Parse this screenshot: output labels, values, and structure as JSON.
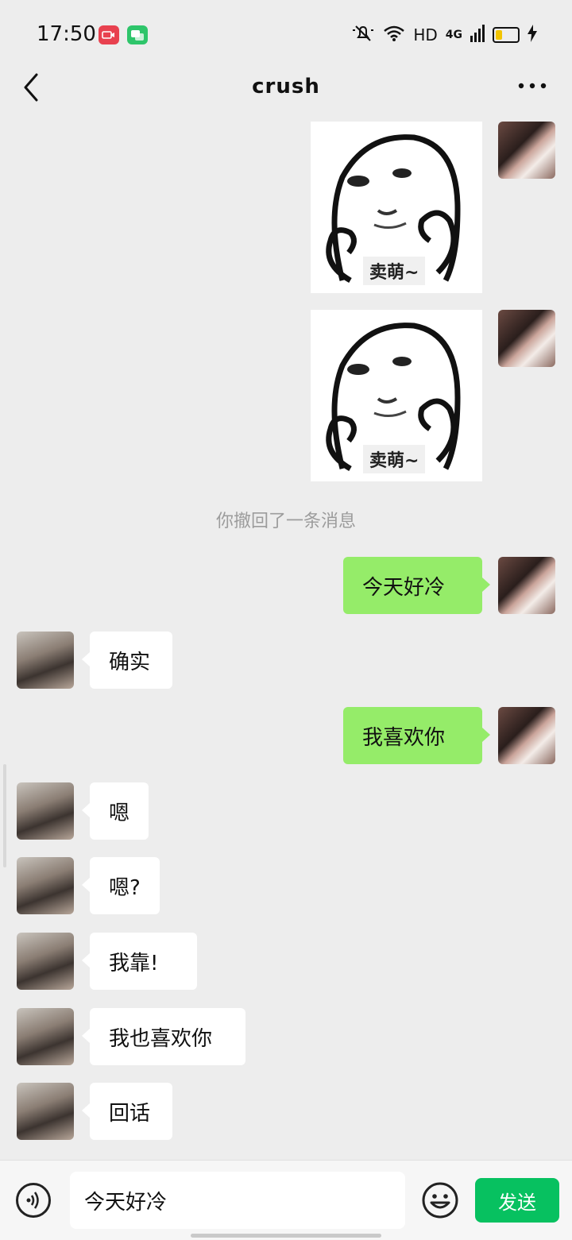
{
  "status_bar": {
    "time": "17:50",
    "hd_label": "HD",
    "network_label": "4G",
    "battery_level": 0.3
  },
  "header": {
    "back_icon": "chevron-left-icon",
    "title": "crush",
    "more_icon": "more-dots-icon"
  },
  "messages": [
    {
      "sender": "me",
      "type": "sticker",
      "caption": "卖萌~"
    },
    {
      "sender": "me",
      "type": "sticker",
      "caption": "卖萌~"
    },
    {
      "type": "system",
      "text": "你撤回了一条消息"
    },
    {
      "sender": "me",
      "type": "text",
      "text": "今天好冷"
    },
    {
      "sender": "them",
      "type": "text",
      "text": "确实"
    },
    {
      "sender": "me",
      "type": "text",
      "text": "我喜欢你"
    },
    {
      "sender": "them",
      "type": "text",
      "text": "嗯"
    },
    {
      "sender": "them",
      "type": "text",
      "text": "嗯?"
    },
    {
      "sender": "them",
      "type": "text",
      "text": "我靠!"
    },
    {
      "sender": "them",
      "type": "text",
      "text": "我也喜欢你"
    },
    {
      "sender": "them",
      "type": "text",
      "text": "回话"
    }
  ],
  "input_bar": {
    "voice_icon": "voice-icon",
    "input_value": "今天好冷",
    "emoji_icon": "emoji-icon",
    "send_label": "发送"
  },
  "colors": {
    "background": "#ededed",
    "my_bubble": "#95ec69",
    "their_bubble": "#ffffff",
    "send_button": "#07c160",
    "system_text": "#9c9c9c"
  }
}
